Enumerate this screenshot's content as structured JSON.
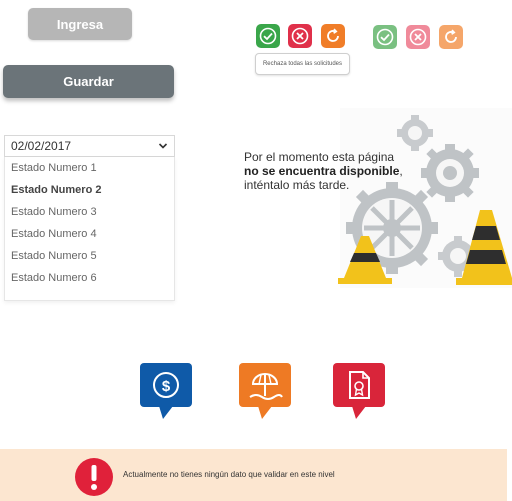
{
  "buttons": {
    "ingresa": "Ingresa",
    "guardar": "Guardar"
  },
  "actions": {
    "group1": [
      "check-icon",
      "close-icon",
      "refresh-icon"
    ],
    "group2": [
      "check-icon",
      "close-icon",
      "refresh-icon"
    ],
    "tooltip": "Rechaza todas las solicitudes"
  },
  "dropdown": {
    "value": "02/02/2017",
    "options": [
      "Estado Numero 1",
      "Estado Numero 2",
      "Estado Numero 3",
      "Estado Numero 4",
      "Estado Numero 5",
      "Estado Numero 6"
    ],
    "selected_index": 1
  },
  "message": {
    "line1": "Por el momento esta página",
    "line2": "no se encuentra disponible",
    "line2_suffix": ",",
    "line3": "inténtalo más tarde."
  },
  "banner": {
    "text": "Actualmente no tienes ningún dato que validar en este nivel"
  },
  "colors": {
    "green": "#3aa64a",
    "red": "#e0304a",
    "orange": "#f07d28",
    "blue_badge": "#0f5aa8",
    "orange_badge": "#ee7a24",
    "red_badge": "#d9253a",
    "banner_bg": "#fce6d0",
    "banner_icon": "#e0213a"
  }
}
